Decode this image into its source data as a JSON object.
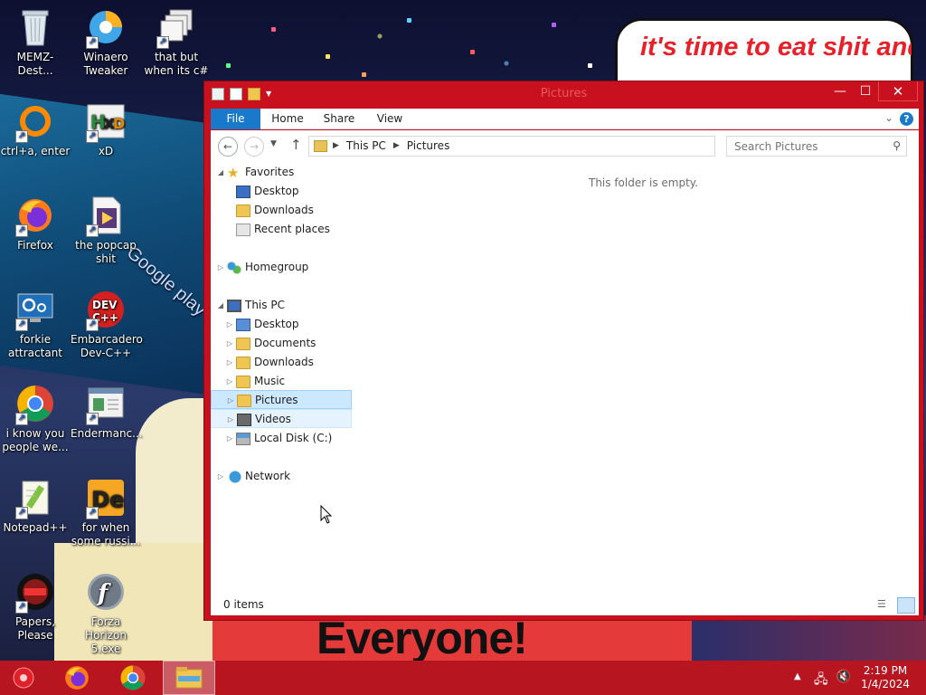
{
  "desktop": {
    "icons": [
      {
        "label": "MEMZ-Dest..."
      },
      {
        "label": "Winaero Tweaker"
      },
      {
        "label": "that but when its c#"
      },
      {
        "label": "ctrl+a, enter"
      },
      {
        "label": "xD"
      },
      {
        "label": "Firefox"
      },
      {
        "label": "the popcap shit"
      },
      {
        "label": "forkie attractant"
      },
      {
        "label": "Embarcadero Dev-C++"
      },
      {
        "label": "i know you people we..."
      },
      {
        "label": "Endermanc..."
      },
      {
        "label": "Notepad++"
      },
      {
        "label": "for when some russi..."
      },
      {
        "label": "Papers, Please"
      },
      {
        "label": "Forza Horizon 5.exe"
      }
    ],
    "wallpaper_bubble": "it's time to eat shit and die andoolobrato",
    "wallpaper_banner": "Everyone!",
    "wallpaper_sign": "Google play"
  },
  "window": {
    "title": "Pictures",
    "controls": {
      "minimize": "—",
      "maximize": "☐",
      "close": "✕"
    },
    "ribbon_tabs": [
      "File",
      "Home",
      "Share",
      "View"
    ],
    "address": {
      "crumbs": [
        "This PC",
        "Pictures"
      ]
    },
    "search": {
      "placeholder": "Search Pictures"
    },
    "empty_message": "This folder is empty.",
    "status": {
      "item_count": "0 items"
    },
    "nav": {
      "favorites": {
        "label": "Favorites",
        "items": [
          "Desktop",
          "Downloads",
          "Recent places"
        ]
      },
      "homegroup": {
        "label": "Homegroup"
      },
      "thispc": {
        "label": "This PC",
        "items": [
          "Desktop",
          "Documents",
          "Downloads",
          "Music",
          "Pictures",
          "Videos",
          "Local Disk (C:)"
        ]
      },
      "network": {
        "label": "Network"
      }
    }
  },
  "taskbar": {
    "clock": {
      "time": "2:19 PM",
      "date": "1/4/2024"
    }
  },
  "colors": {
    "window_frame": "#c8101e",
    "taskbar": "#b71621",
    "file_tab": "#1979ca",
    "selection": "#cce8ff"
  }
}
